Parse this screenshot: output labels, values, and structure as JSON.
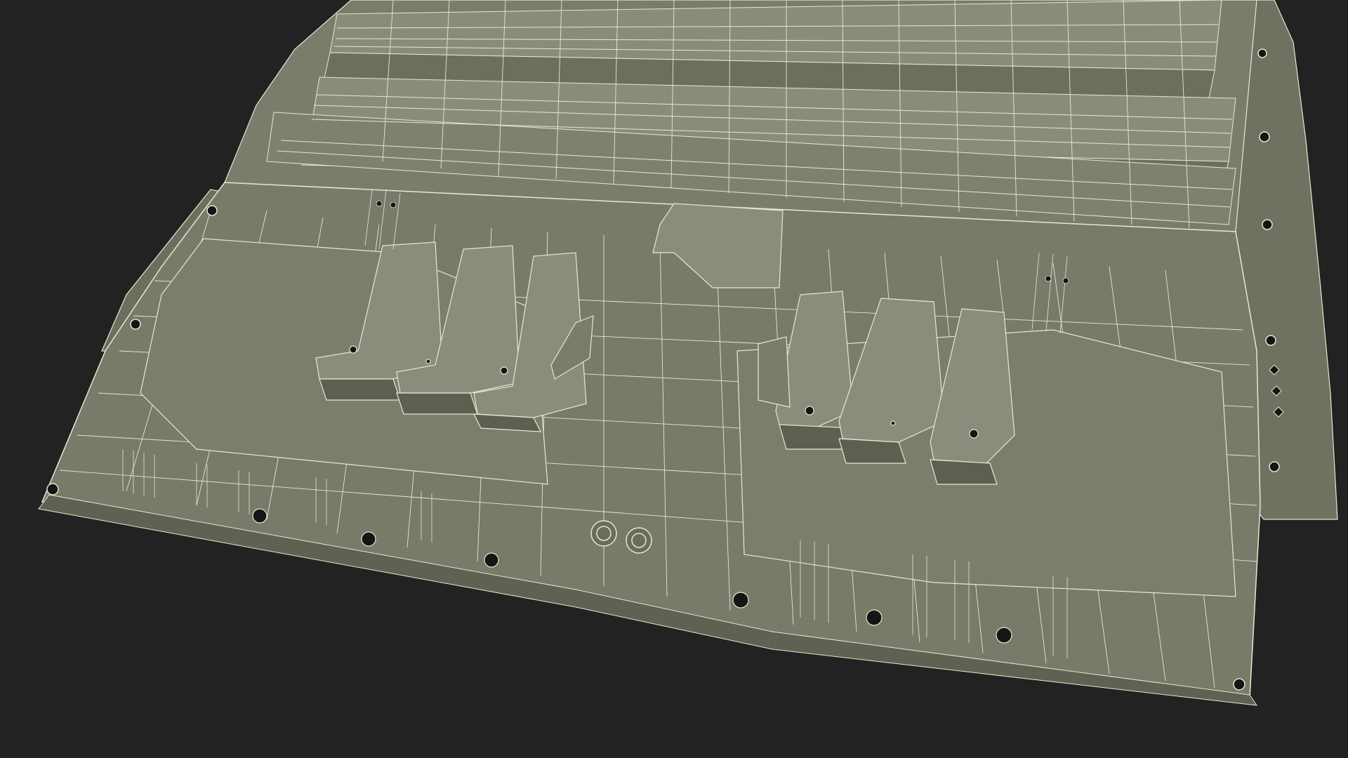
{
  "scene": {
    "subject": "wireframe-floor-pan-model",
    "colors": {
      "background": "#222222",
      "surface": "#787a6a",
      "surface_dark": "#6a6c5c",
      "surface_light": "#868877",
      "wire": "#e9e6cf",
      "hole": "#151515"
    }
  }
}
